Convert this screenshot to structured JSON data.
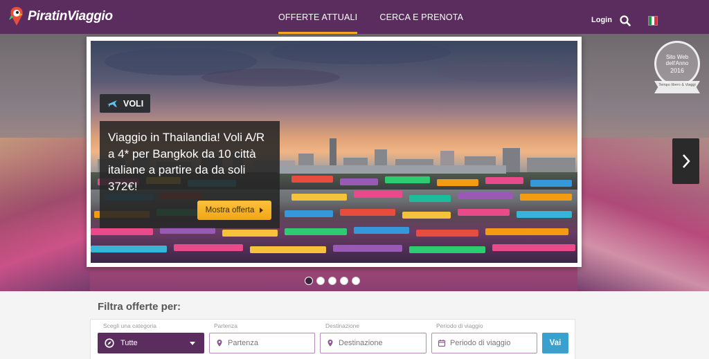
{
  "brand": {
    "name": "PiratinViaggio"
  },
  "nav": {
    "items": [
      {
        "label": "OFFERTE ATTUALI"
      },
      {
        "label": "CERCA E PRENOTA"
      }
    ]
  },
  "header": {
    "login_label": "Login"
  },
  "hero": {
    "tag": "VOLI",
    "title": "Viaggio in Thailandia! Voli A/R a 4* per Bangkok da 10 città italiane a partire da da soli 372€!",
    "cta_label": "Mostra offerta",
    "slides_total": 5,
    "slide_active": 1
  },
  "badge": {
    "line1": "Sito Web",
    "line2": "dell'Anno",
    "year": "2016",
    "ribbon": "Tempo libero & Viaggi"
  },
  "filter": {
    "title": "Filtra offerte per:",
    "category": {
      "label": "Scegli una categoria",
      "value": "Tutte"
    },
    "departure": {
      "label": "Partenza",
      "placeholder": "Partenza"
    },
    "destination": {
      "label": "Destinazione",
      "placeholder": "Destinazione"
    },
    "period": {
      "label": "Periodo di viaggio",
      "placeholder": "Periodo di viaggio"
    },
    "submit_label": "Vai"
  },
  "colors": {
    "brand_purple": "#5b2d5f",
    "accent_orange": "#f5a623",
    "button_blue": "#3aa1cf"
  },
  "icons": [
    "parrot-logo-icon",
    "search-icon",
    "italy-flag-icon",
    "plane-icon",
    "chevron-right-icon",
    "compass-icon",
    "map-pin-icon",
    "calendar-icon"
  ]
}
